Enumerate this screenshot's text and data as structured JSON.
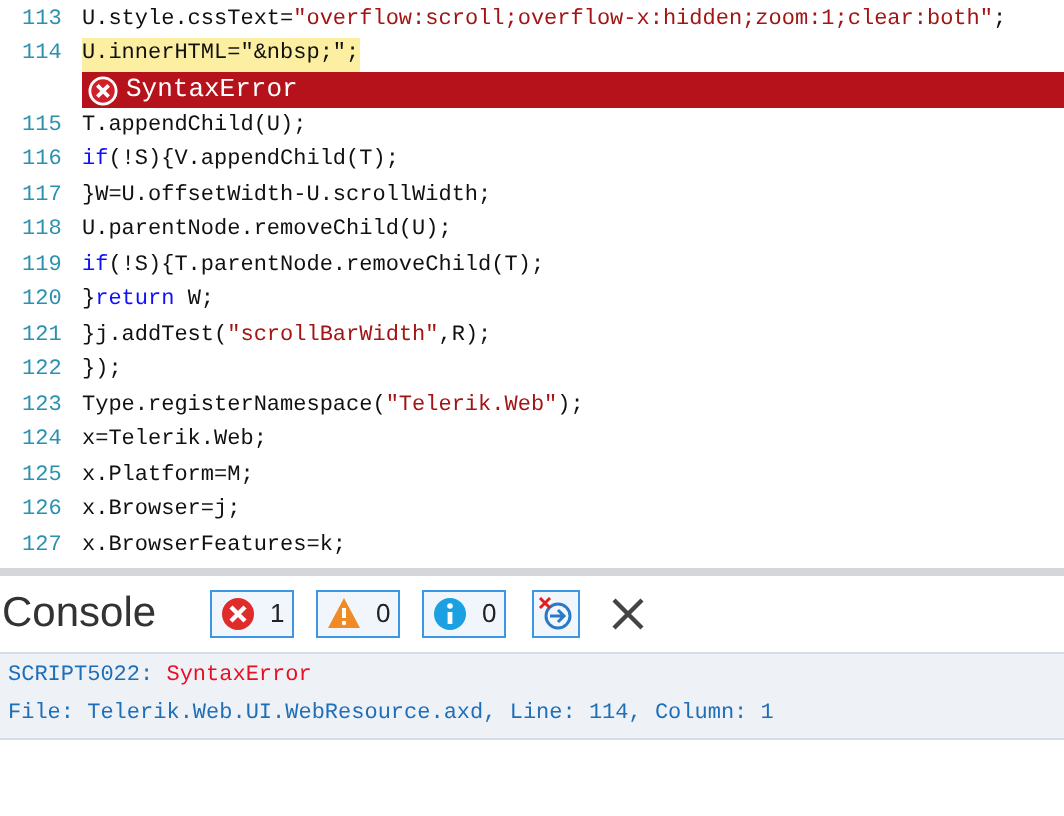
{
  "editor": {
    "lines": [
      {
        "kind": "code",
        "number": "113",
        "highlighted": false,
        "tokens": [
          {
            "text": "U.style.cssText=",
            "kind": "plain"
          },
          {
            "text": "\"overflow:scroll;overflow-x:hidden;zoom:1;clear:both\"",
            "kind": "string"
          },
          {
            "text": ";",
            "kind": "plain"
          }
        ]
      },
      {
        "kind": "code",
        "number": "114",
        "highlighted": true,
        "tokens": [
          {
            "text": "U.innerHTML=",
            "kind": "plain"
          },
          {
            "text": "\"&nbsp;\"",
            "kind": "plain"
          },
          {
            "text": ";",
            "kind": "plain"
          }
        ]
      },
      {
        "kind": "error",
        "message": "SyntaxError"
      },
      {
        "kind": "code",
        "number": "115",
        "highlighted": false,
        "tokens": [
          {
            "text": "T.appendChild(U);",
            "kind": "plain"
          }
        ]
      },
      {
        "kind": "code",
        "number": "116",
        "highlighted": false,
        "tokens": [
          {
            "text": "if",
            "kind": "keyword"
          },
          {
            "text": "(!S){V.appendChild(T);",
            "kind": "plain"
          }
        ]
      },
      {
        "kind": "code",
        "number": "117",
        "highlighted": false,
        "tokens": [
          {
            "text": "}W=U.offsetWidth-U.scrollWidth;",
            "kind": "plain"
          }
        ]
      },
      {
        "kind": "code",
        "number": "118",
        "highlighted": false,
        "tokens": [
          {
            "text": "U.parentNode.removeChild(U);",
            "kind": "plain"
          }
        ]
      },
      {
        "kind": "code",
        "number": "119",
        "highlighted": false,
        "tokens": [
          {
            "text": "if",
            "kind": "keyword"
          },
          {
            "text": "(!S){T.parentNode.removeChild(T);",
            "kind": "plain"
          }
        ]
      },
      {
        "kind": "code",
        "number": "120",
        "highlighted": false,
        "tokens": [
          {
            "text": "}",
            "kind": "plain"
          },
          {
            "text": "return",
            "kind": "keyword"
          },
          {
            "text": " W;",
            "kind": "plain"
          }
        ]
      },
      {
        "kind": "code",
        "number": "121",
        "highlighted": false,
        "tokens": [
          {
            "text": "}j.addTest(",
            "kind": "plain"
          },
          {
            "text": "\"scrollBarWidth\"",
            "kind": "string"
          },
          {
            "text": ",R);",
            "kind": "plain"
          }
        ]
      },
      {
        "kind": "code",
        "number": "122",
        "highlighted": false,
        "tokens": [
          {
            "text": "});",
            "kind": "plain"
          }
        ]
      },
      {
        "kind": "code",
        "number": "123",
        "highlighted": false,
        "tokens": [
          {
            "text": "Type.registerNamespace(",
            "kind": "plain"
          },
          {
            "text": "\"Telerik.Web\"",
            "kind": "string"
          },
          {
            "text": ");",
            "kind": "plain"
          }
        ]
      },
      {
        "kind": "code",
        "number": "124",
        "highlighted": false,
        "tokens": [
          {
            "text": "x=Telerik.Web;",
            "kind": "plain"
          }
        ]
      },
      {
        "kind": "code",
        "number": "125",
        "highlighted": false,
        "tokens": [
          {
            "text": "x.Platform=M;",
            "kind": "plain"
          }
        ]
      },
      {
        "kind": "code",
        "number": "126",
        "highlighted": false,
        "tokens": [
          {
            "text": "x.Browser=j;",
            "kind": "plain"
          }
        ]
      },
      {
        "kind": "code",
        "number": "127",
        "highlighted": false,
        "tokens": [
          {
            "text": "x.BrowserFeatures=k;",
            "kind": "plain"
          }
        ]
      }
    ]
  },
  "console": {
    "title": "Console",
    "filters": [
      {
        "kind": "error",
        "count": "1"
      },
      {
        "kind": "warning",
        "count": "0"
      },
      {
        "kind": "info",
        "count": "0"
      }
    ],
    "messages": [
      {
        "parts": [
          {
            "text": "SCRIPT5022:",
            "kind": "code"
          },
          {
            "text": " SyntaxError",
            "kind": "error"
          }
        ]
      },
      {
        "parts": [
          {
            "text": "File: Telerik.Web.UI.WebResource.axd, Line: 114, Column: 1",
            "kind": "code"
          }
        ]
      }
    ]
  }
}
